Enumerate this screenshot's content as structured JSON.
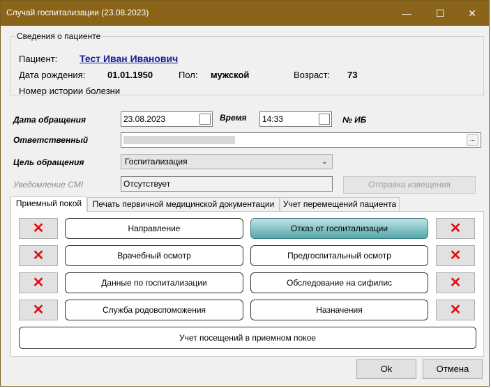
{
  "window": {
    "title": "Случай госпитализации (23.08.2023)",
    "min_glyph": "—",
    "max_glyph": "☐",
    "close_glyph": "✕"
  },
  "patient": {
    "group_title": "Сведения о пациенте",
    "patient_label": "Пациент:",
    "patient_name": "Тест Иван Иванович",
    "dob_label": "Дата рождения:",
    "dob_value": "01.01.1950",
    "sex_label": "Пол:",
    "sex_value": "мужской",
    "age_label": "Возраст:",
    "age_value": "73",
    "history_label": "Номер истории болезни"
  },
  "form": {
    "date_label": "Дата обращения",
    "date_value": "23.08.2023",
    "time_label": "Время",
    "time_value": "14:33",
    "ib_label": "№ ИБ",
    "responsible_label": "Ответственный",
    "responsible_browse": "...",
    "purpose_label": "Цель обращения",
    "purpose_value": "Госпитализация",
    "cmi_label": "Уведомление CMI",
    "cmi_value": "Отсутствует",
    "send_notice_label": "Отправка извещения"
  },
  "tabs": [
    {
      "label": "Приемный покой"
    },
    {
      "label": "Печать первичной медицинской документации"
    },
    {
      "label": "Учет перемещений пациента"
    }
  ],
  "actions": {
    "delete_glyph": "✕",
    "left": [
      "Направление",
      "Врачебный осмотр",
      "Данные по госпитализации",
      "Служба родовспоможения"
    ],
    "right": [
      "Отказ от госпитализации",
      "Предгоспитальный осмотр",
      "Обследование на сифилис",
      "Назначения"
    ],
    "visits": "Учет посещений в приемном покое"
  },
  "footer": {
    "ok": "Ok",
    "cancel": "Отмена"
  },
  "colors": {
    "titlebar": "#8a6519",
    "delete": "#e01010",
    "highlight": "#54a7aa"
  }
}
